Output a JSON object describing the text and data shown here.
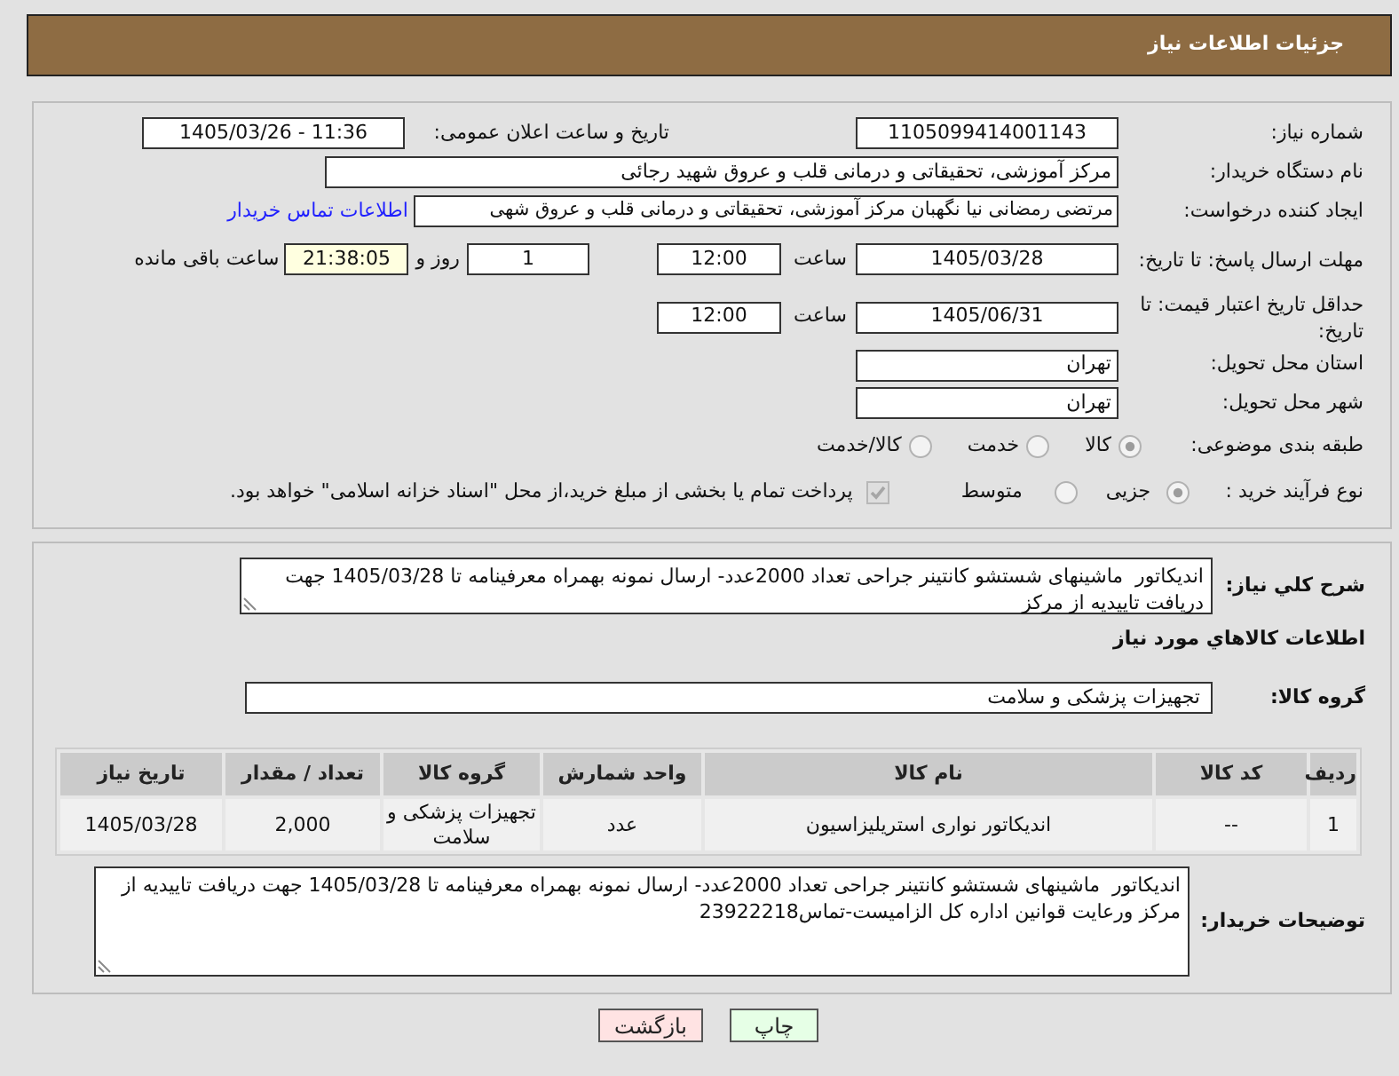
{
  "header": {
    "title": "جزئیات اطلاعات نیاز"
  },
  "need_number": {
    "label": "شماره نیاز:",
    "value": "1105099414001143"
  },
  "announcement": {
    "label": "تاریخ و ساعت اعلان عمومی:",
    "value": "1405/03/26 - 11:36"
  },
  "buyer_org": {
    "label": "نام دستگاه خریدار:",
    "value": "مرکز آموزشی، تحقیقاتی و درمانی قلب و عروق شهید رجائی"
  },
  "requester": {
    "label": "ایجاد کننده درخواست:",
    "value": "مرتضی رمضانی نیا نگهبان مرکز آموزشی، تحقیقاتی و درمانی قلب و عروق شهی",
    "link": "اطلاعات تماس خریدار"
  },
  "response_deadline": {
    "label": "مهلت ارسال پاسخ: تا تاریخ:",
    "date": "1405/03/28",
    "time_label": "ساعت",
    "time": "12:00",
    "days": "1",
    "days_label": "روز و",
    "remaining": "21:38:05",
    "remaining_label": "ساعت باقی مانده"
  },
  "price_validity": {
    "label": "حداقل تاریخ اعتبار قیمت: تا تاریخ:",
    "date": "1405/06/31",
    "time_label": "ساعت",
    "time": "12:00"
  },
  "delivery_province": {
    "label": "استان محل تحویل:",
    "value": "تهران"
  },
  "delivery_city": {
    "label": "شهر محل تحویل:",
    "value": "تهران"
  },
  "subject_category": {
    "label": "طبقه بندی موضوعی:",
    "options": [
      {
        "label": "کالا",
        "selected": true
      },
      {
        "label": "خدمت",
        "selected": false
      },
      {
        "label": "کالا/خدمت",
        "selected": false
      }
    ]
  },
  "purchase_process": {
    "label": "نوع فرآیند خرید :",
    "options": [
      {
        "label": "جزیی",
        "selected": true
      },
      {
        "label": "متوسط",
        "selected": false
      }
    ],
    "treasury_payment": {
      "label": "پرداخت تمام یا بخشی از مبلغ خرید،از محل \"اسناد خزانه اسلامی\" خواهد بود.",
      "checked": true
    }
  },
  "description": {
    "label": "شرح کلي نیاز:",
    "value": "اندیکاتور  ماشینهای شستشو کانتینر جراحی تعداد 2000عدد- ارسال نمونه بهمراه معرفینامه تا 1405/03/28 جهت دریافت تاییدیه از مرکز"
  },
  "goods_section": {
    "title": "اطلاعات کالاهاي مورد نیاز",
    "group_label": "گروه کالا:",
    "group_value": "تجهیزات پزشکی و سلامت",
    "table": {
      "columns": [
        "ردیف",
        "کد کالا",
        "نام کالا",
        "واحد شمارش",
        "گروه کالا",
        "تعداد / مقدار",
        "تاریخ نیاز"
      ],
      "rows": [
        [
          "1",
          "--",
          "اندیکاتور نواری استریلیزاسیون",
          "عدد",
          "تجهیزات پزشکی و سلامت",
          "2,000",
          "1405/03/28"
        ]
      ]
    }
  },
  "buyer_notes": {
    "label": "توضیحات خریدار:",
    "value": "اندیکاتور  ماشینهای شستشو کانتینر جراحی تعداد 2000عدد- ارسال نمونه بهمراه معرفینامه تا 1405/03/28 جهت دریافت تاییدیه از مرکز ورعایت قوانین اداره کل الزامیست-تماس23922218"
  },
  "buttons": [
    {
      "label": "چاپ",
      "kind": "print"
    },
    {
      "label": "بازگشت",
      "kind": "back"
    }
  ]
}
